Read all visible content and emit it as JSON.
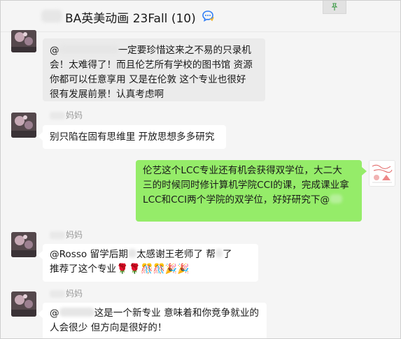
{
  "window": {
    "title": "BA英美动画 23Fall (10)"
  },
  "messages": [
    {
      "direction": "in",
      "sender": "",
      "lines": [
        {
          "prefix": "@",
          "suffix": "一定要珍惜这来之不易的只录机"
        },
        {
          "text": "会！太难得了！而且伦艺所有学校的图书馆 资源"
        },
        {
          "text": "你都可以任意享用 又是在伦敦 这个专业也很好"
        },
        {
          "text": "很有发展前景！认真考虑啊"
        }
      ]
    },
    {
      "direction": "in",
      "sender": "妈妈",
      "lines": [
        {
          "text": "别只陷在固有思维里 开放思想多多研究"
        }
      ]
    },
    {
      "direction": "out",
      "lines": [
        {
          "text": "伦艺这个LCC专业还有机会获得双学位，大二大"
        },
        {
          "text": "三的时候同时修计算机学院CCI的课，完成课业拿"
        },
        {
          "prefix": "LCC和CCI两个学院的双学位，好好研究下@"
        }
      ]
    },
    {
      "direction": "in",
      "sender": "妈妈",
      "lines": [
        {
          "prefix": "@Rosso 留学后期",
          "middle": "太感谢王老师了 帮",
          "suffix": "了"
        },
        {
          "text": "推荐了这个专业",
          "emoji": "🌹🌹🎊🎊🎉🎉"
        }
      ]
    },
    {
      "direction": "in",
      "sender": "妈妈",
      "lines": [
        {
          "prefix": "@",
          "suffix": "这是一个新专业 意味着和你竞争就业的"
        },
        {
          "text": "人会很少 但方向是很好的！"
        }
      ]
    }
  ],
  "colors": {
    "out_bubble": "#95ec69",
    "in_bubble": "#ffffff",
    "background": "#f5f5f5"
  },
  "icons": {
    "title_icon": "chat-bubble-icon",
    "pin": "pin-icon"
  }
}
